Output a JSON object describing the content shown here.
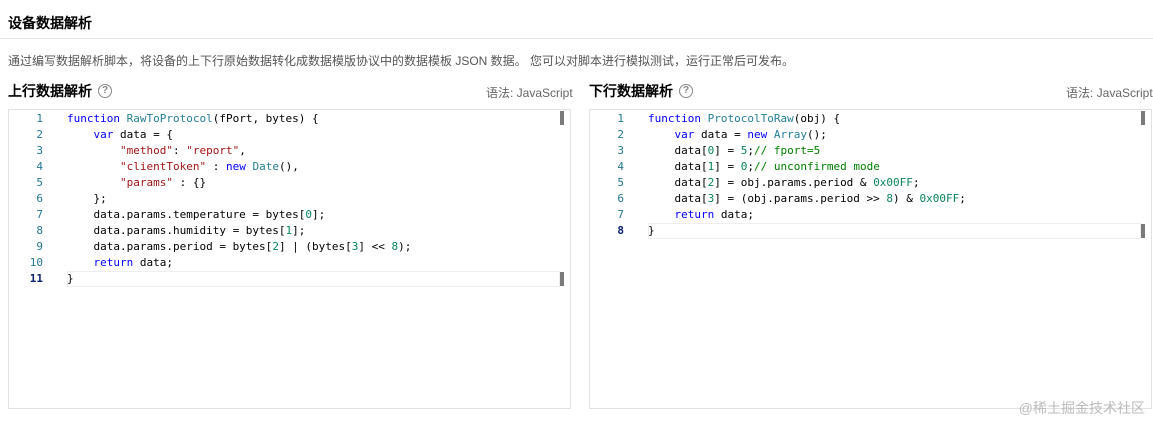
{
  "page": {
    "title": "设备数据解析",
    "description": "通过编写数据解析脚本，将设备的上下行原始数据转化成数据模版协议中的数据模板 JSON 数据。 您可以对脚本进行模拟测试，运行正常后可发布。"
  },
  "uplink": {
    "title": "上行数据解析",
    "help_icon": "?",
    "language": "语法: JavaScript",
    "active_line": 11,
    "lines": [
      [
        [
          "kw",
          "function "
        ],
        [
          "fn",
          "RawToProtocol"
        ],
        [
          "",
          "(fPort, bytes) {"
        ]
      ],
      [
        [
          "",
          "    "
        ],
        [
          "kw",
          "var"
        ],
        [
          "",
          " data = {"
        ]
      ],
      [
        [
          "",
          "        "
        ],
        [
          "str",
          "\"method\""
        ],
        [
          "",
          ": "
        ],
        [
          "str",
          "\"report\""
        ],
        [
          "",
          ","
        ]
      ],
      [
        [
          "",
          "        "
        ],
        [
          "str",
          "\"clientToken\""
        ],
        [
          "",
          " : "
        ],
        [
          "kw",
          "new "
        ],
        [
          "fn",
          "Date"
        ],
        [
          "",
          "(),"
        ]
      ],
      [
        [
          "",
          "        "
        ],
        [
          "str",
          "\"params\""
        ],
        [
          "",
          " : {}"
        ]
      ],
      [
        [
          "",
          "    };"
        ]
      ],
      [
        [
          "",
          "    data.params.temperature = bytes["
        ],
        [
          "num",
          "0"
        ],
        [
          "",
          "];"
        ]
      ],
      [
        [
          "",
          "    data.params.humidity = bytes["
        ],
        [
          "num",
          "1"
        ],
        [
          "",
          "];"
        ]
      ],
      [
        [
          "",
          "    data.params.period = bytes["
        ],
        [
          "num",
          "2"
        ],
        [
          "",
          "] | (bytes["
        ],
        [
          "num",
          "3"
        ],
        [
          "",
          "] << "
        ],
        [
          "num",
          "8"
        ],
        [
          "",
          ");"
        ]
      ],
      [
        [
          "",
          "    "
        ],
        [
          "kw",
          "return"
        ],
        [
          "",
          " data;"
        ]
      ],
      [
        [
          "",
          "}"
        ]
      ]
    ]
  },
  "downlink": {
    "title": "下行数据解析",
    "help_icon": "?",
    "language": "语法: JavaScript",
    "active_line": 8,
    "lines": [
      [
        [
          "kw",
          "function "
        ],
        [
          "fn",
          "ProtocolToRaw"
        ],
        [
          "",
          "(obj) {"
        ]
      ],
      [
        [
          "",
          "    "
        ],
        [
          "kw",
          "var"
        ],
        [
          "",
          " data = "
        ],
        [
          "kw",
          "new "
        ],
        [
          "fn",
          "Array"
        ],
        [
          "",
          "();"
        ]
      ],
      [
        [
          "",
          "    data["
        ],
        [
          "num",
          "0"
        ],
        [
          "",
          "] = "
        ],
        [
          "num",
          "5"
        ],
        [
          "",
          ";"
        ],
        [
          "cm",
          "// fport=5"
        ]
      ],
      [
        [
          "",
          "    data["
        ],
        [
          "num",
          "1"
        ],
        [
          "",
          "] = "
        ],
        [
          "num",
          "0"
        ],
        [
          "",
          ";"
        ],
        [
          "cm",
          "// unconfirmed mode"
        ]
      ],
      [
        [
          "",
          "    data["
        ],
        [
          "num",
          "2"
        ],
        [
          "",
          "] = obj.params.period & "
        ],
        [
          "num",
          "0x00FF"
        ],
        [
          "",
          ";"
        ]
      ],
      [
        [
          "",
          "    data["
        ],
        [
          "num",
          "3"
        ],
        [
          "",
          "] = (obj.params.period >> "
        ],
        [
          "num",
          "8"
        ],
        [
          "",
          ") & "
        ],
        [
          "num",
          "0x00FF"
        ],
        [
          "",
          ";"
        ]
      ],
      [
        [
          "",
          "    "
        ],
        [
          "kw",
          "return"
        ],
        [
          "",
          " data;"
        ]
      ],
      [
        [
          "",
          "}"
        ]
      ]
    ]
  },
  "watermark": "@稀土掘金技术社区"
}
